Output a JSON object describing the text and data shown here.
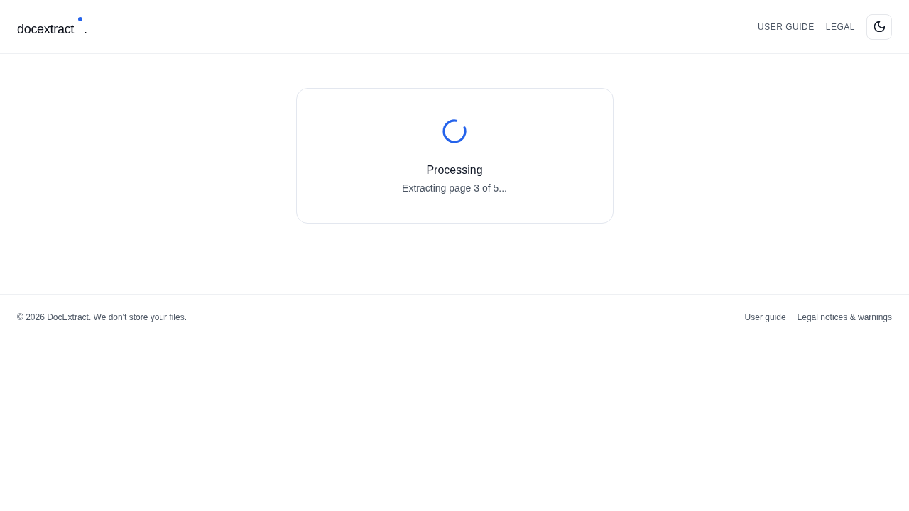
{
  "header": {
    "logo": {
      "text": "docextract",
      "suffix": "."
    },
    "nav": [
      {
        "label": "USER GUIDE"
      },
      {
        "label": "LEGAL"
      }
    ]
  },
  "status_card": {
    "title": "Processing",
    "message": "Extracting page 3 of 5..."
  },
  "footer": {
    "copyright": "© 2026 DocExtract. We don't store your files.",
    "links": [
      {
        "label": "User guide"
      },
      {
        "label": "Legal notices & warnings"
      }
    ]
  }
}
